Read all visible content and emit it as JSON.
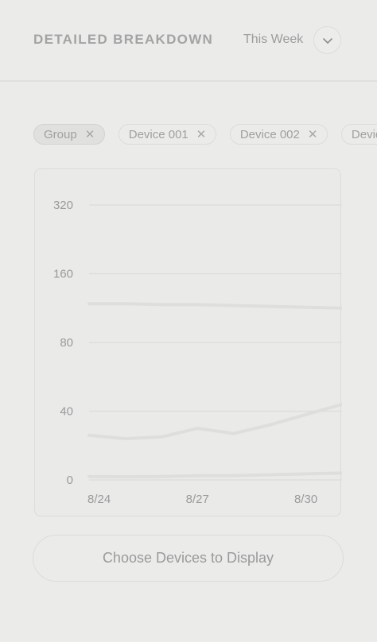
{
  "header": {
    "title": "DETAILED BREAKDOWN",
    "range_label": "This Week",
    "range_toggle_icon": "chevron-down-icon"
  },
  "filters": [
    {
      "label": "Group",
      "active": true
    },
    {
      "label": "Device 001",
      "active": false
    },
    {
      "label": "Device 002",
      "active": false
    },
    {
      "label": "Devic",
      "active": false
    }
  ],
  "chart_data": {
    "type": "line",
    "x": [
      "8/24",
      "8/25",
      "8/26",
      "8/27",
      "8/28",
      "8/29",
      "8/30",
      "8/31"
    ],
    "x_ticks": [
      "8/24",
      "8/27",
      "8/30"
    ],
    "y_ticks": [
      "0",
      "40",
      "80",
      "160",
      "320"
    ],
    "y_tick_values": [
      0,
      40,
      80,
      160,
      320
    ],
    "ylim": [
      0,
      320
    ],
    "series": [
      {
        "values": [
          125,
          125,
          124,
          124,
          123,
          122,
          121,
          120
        ]
      },
      {
        "values": [
          26,
          24,
          25,
          30,
          27,
          32,
          38,
          44
        ]
      },
      {
        "values": [
          2,
          1.8,
          2,
          2.4,
          2.5,
          3,
          3.5,
          4
        ]
      }
    ],
    "grid": true,
    "legend": "none"
  },
  "actions": {
    "choose_devices": "Choose Devices to Display"
  },
  "colors": {
    "background": "#ebebea",
    "line": "#dededd",
    "grid": "#dcdcdb",
    "text": "#9a9a9a"
  }
}
